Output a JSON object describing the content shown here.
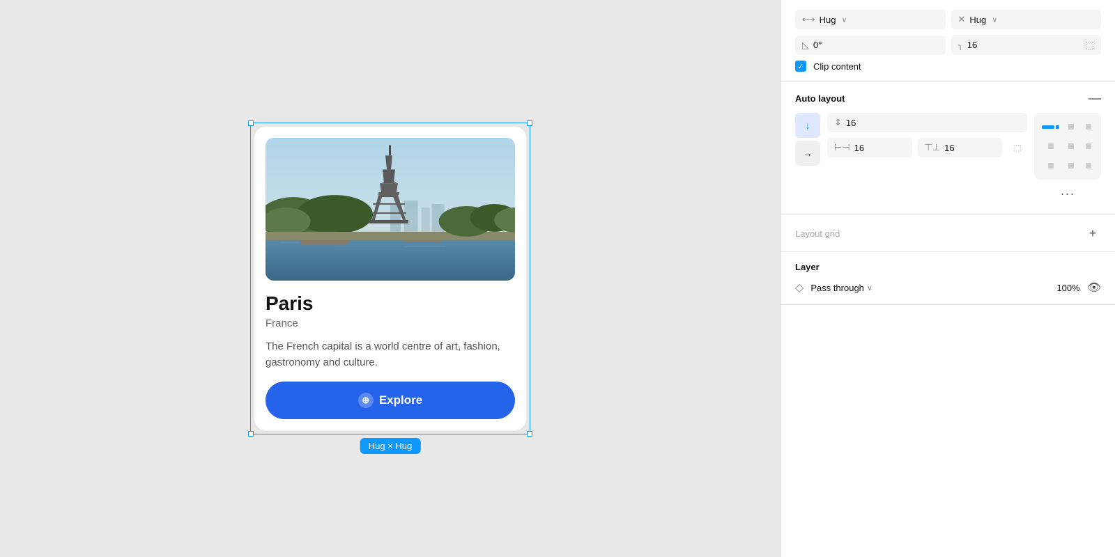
{
  "canvas": {
    "background": "#e8e8e8"
  },
  "card": {
    "title": "Paris",
    "subtitle": "France",
    "description": "The French capital is a world centre of art, fashion, gastronomy and culture.",
    "button_label": "Explore",
    "hug_label": "Hug × Hug"
  },
  "right_panel": {
    "width_label": "Hug",
    "height_label": "Hug",
    "rotation_label": "0°",
    "corner_radius_label": "16",
    "clip_content_label": "Clip content",
    "auto_layout": {
      "section_title": "Auto layout",
      "gap_value": "16",
      "padding_horizontal": "16",
      "padding_vertical": "16"
    },
    "layout_grid": {
      "section_title": "Layout grid"
    },
    "layer": {
      "section_title": "Layer",
      "mode_label": "Pass through",
      "opacity_label": "100%"
    }
  }
}
